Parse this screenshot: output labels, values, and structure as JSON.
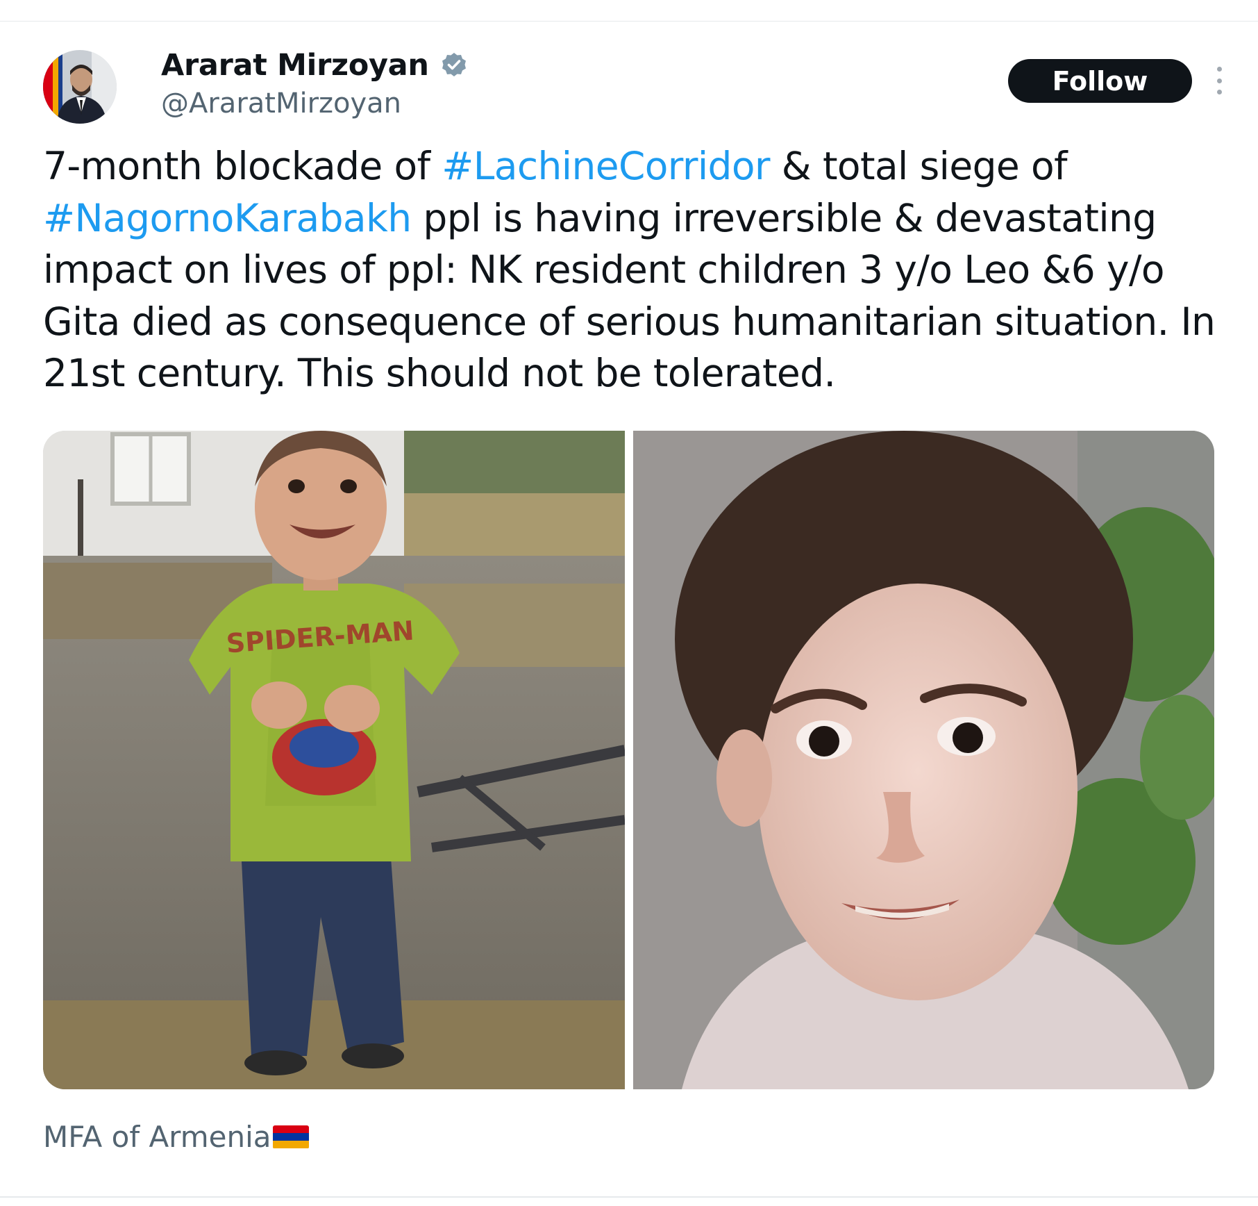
{
  "author": {
    "name": "Ararat Mirzoyan",
    "handle": "@AraratMirzoyan",
    "verified_icon": "verified-badge-icon"
  },
  "actions": {
    "follow_label": "Follow",
    "more_icon": "more-vertical-icon"
  },
  "tweet": {
    "lines": [
      {
        "pre": "7-month blockade of ",
        "tag": "#LachineCorridor",
        "post": " & total siege of"
      },
      {
        "pre": "",
        "tag": "#NagornoKarabakh",
        "post": " ppl is having irreversible & devastating"
      },
      {
        "pre": "impact on lives of ppl: NK resident children 3 y/o Leo &6 y/o",
        "tag": "",
        "post": ""
      },
      {
        "pre": "Gita died as consequence of serious humanitarian situation. In",
        "tag": "",
        "post": ""
      },
      {
        "pre": "21st century. This should not be tolerated.",
        "tag": "",
        "post": ""
      }
    ]
  },
  "media": {
    "photos": [
      {
        "name": "photo-child-leo",
        "shirt_text": "SPIDER-MAN"
      },
      {
        "name": "photo-child-gita"
      }
    ]
  },
  "footer": {
    "source": "MFA of Armenia",
    "flag_colors": [
      "#d90012",
      "#0033a0",
      "#f2a800"
    ]
  },
  "colors": {
    "link": "#1d9bf0",
    "secondary": "#536471",
    "primary": "#0f1419"
  }
}
